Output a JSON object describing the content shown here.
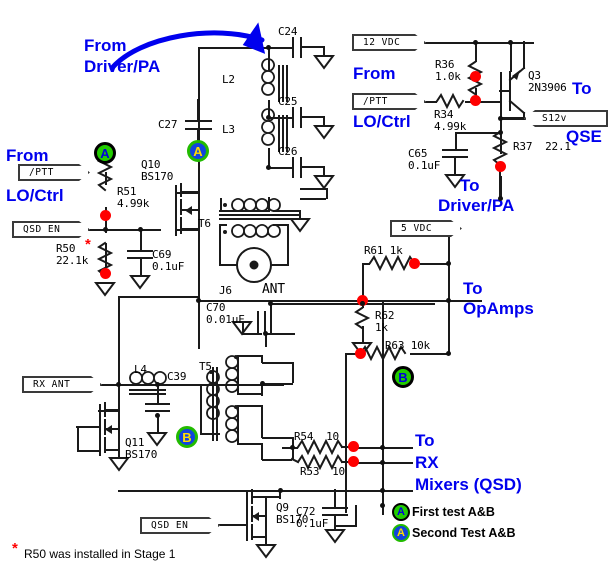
{
  "title": "Softrock RXTX Stage QSD/QSE schematic - test points A&B",
  "colors": {
    "wire": "#1a1a1a",
    "annotation": "#0000EE",
    "junction": "#FF0000",
    "badge_first_fill": "#22CC00",
    "badge_first_text": "#0000DD",
    "badge_second_fill": "#1144DD",
    "badge_second_text": "#FFDD00",
    "badge_second_ring": "#22BB00",
    "asterisk": "#FF0000"
  },
  "annotations": [
    {
      "id": "from-driver-pa",
      "line1": "From",
      "line2": "Driver/PA"
    },
    {
      "id": "from-lo-ctrl-left",
      "line1": "From",
      "line2": "LO/Ctrl"
    },
    {
      "id": "from-lo-ctrl-right",
      "line1": "From",
      "line2": "LO/Ctrl"
    },
    {
      "id": "to-qse",
      "line1": "To",
      "line2": "QSE"
    },
    {
      "id": "to-driver-pa",
      "line1": "To",
      "line2": "Driver/PA"
    },
    {
      "id": "to-opamps",
      "line1": "To",
      "line2": "OpAmps"
    },
    {
      "id": "to-rx-mixers",
      "line1": "To",
      "line2": "RX",
      "line3": "Mixers (QSD)"
    }
  ],
  "ports": [
    {
      "id": "ptt-left",
      "label": "/PTT"
    },
    {
      "id": "qsd-en-left",
      "label": "QSD EN"
    },
    {
      "id": "12vdc",
      "label": "12 VDC"
    },
    {
      "id": "ptt-right",
      "label": "/PTT"
    },
    {
      "id": "s12v",
      "label": "S12v"
    },
    {
      "id": "5vdc",
      "label": "5 VDC"
    },
    {
      "id": "rx-ant",
      "label": "RX ANT"
    },
    {
      "id": "qsd-en-bottom",
      "label": "QSD EN"
    }
  ],
  "components": [
    {
      "ref": "C24",
      "value": ""
    },
    {
      "ref": "C25",
      "value": ""
    },
    {
      "ref": "C26",
      "value": ""
    },
    {
      "ref": "C27",
      "value": ""
    },
    {
      "ref": "L2",
      "value": ""
    },
    {
      "ref": "L3",
      "value": ""
    },
    {
      "ref": "L4",
      "value": ""
    },
    {
      "ref": "T6",
      "value": ""
    },
    {
      "ref": "T5",
      "value": ""
    },
    {
      "ref": "J6",
      "value": "ANT"
    },
    {
      "ref": "Q10",
      "value": "BS170"
    },
    {
      "ref": "Q11",
      "value": "BS170"
    },
    {
      "ref": "Q9",
      "value": "BS170"
    },
    {
      "ref": "Q3",
      "value": "2N3906"
    },
    {
      "ref": "R51",
      "value": "4.99k"
    },
    {
      "ref": "R50",
      "value": "22.1k"
    },
    {
      "ref": "R36",
      "value": "1.0k"
    },
    {
      "ref": "R34",
      "value": "4.99k"
    },
    {
      "ref": "R37",
      "value": "22.1"
    },
    {
      "ref": "R61",
      "value": "1k"
    },
    {
      "ref": "R62",
      "value": "1k"
    },
    {
      "ref": "R63",
      "value": "10k"
    },
    {
      "ref": "R54",
      "value": "10"
    },
    {
      "ref": "R53",
      "value": "10"
    },
    {
      "ref": "C69",
      "value": "0.1uF"
    },
    {
      "ref": "C65",
      "value": "0.1uF"
    },
    {
      "ref": "C70",
      "value": "0.01uF"
    },
    {
      "ref": "C72",
      "value": "0.1uF"
    },
    {
      "ref": "C39",
      "value": ""
    }
  ],
  "labels": {
    "c24": "C24",
    "c25": "C25",
    "c26": "C26",
    "c27": "C27",
    "l2": "L2",
    "l3": "L3",
    "l4": "L4",
    "t6": "T6",
    "t5": "T5",
    "j6": "J6",
    "ant": "ANT",
    "q10_ref": "Q10",
    "q10_val": "BS170",
    "q11_ref": "Q11",
    "q11_val": "BS170",
    "q9_ref": "Q9",
    "q9_val": "BS170",
    "q3_ref": "Q3",
    "q3_val": "2N3906",
    "r51_ref": "R51",
    "r51_val": "4.99k",
    "r50_ref": "R50",
    "r50_val": "22.1k",
    "r36_ref": "R36",
    "r36_val": "1.0k",
    "r34_ref": "R34",
    "r34_val": "4.99k",
    "r37": "R37  22.1",
    "r61": "R61 1k",
    "r62_ref": "R62",
    "r62_val": "1k",
    "r63": "R63 10k",
    "r54": "R54  10",
    "r53": "R53  10",
    "c69_ref": "C69",
    "c69_val": "0.1uF",
    "c65_ref": "C65",
    "c65_val": "0.1uF",
    "c70_ref": "C70",
    "c70_val": "0.01uF",
    "c72_ref": "C72",
    "c72_val": "0.1uF",
    "c39": "C39"
  },
  "legend": {
    "first": {
      "letter": "A",
      "text": "First test A&B"
    },
    "second": {
      "letter": "A",
      "text": "Second Test A&B"
    }
  },
  "test_points": [
    {
      "id": "tp-a-ptt",
      "letter": "A",
      "kind": "first"
    },
    {
      "id": "tp-a-c27",
      "letter": "A",
      "kind": "second"
    },
    {
      "id": "tp-b-r63",
      "letter": "B",
      "kind": "first"
    },
    {
      "id": "tp-b-c39",
      "letter": "B",
      "kind": "second"
    }
  ],
  "footnote": {
    "marker": "*",
    "text": "R50 was installed in Stage 1"
  }
}
